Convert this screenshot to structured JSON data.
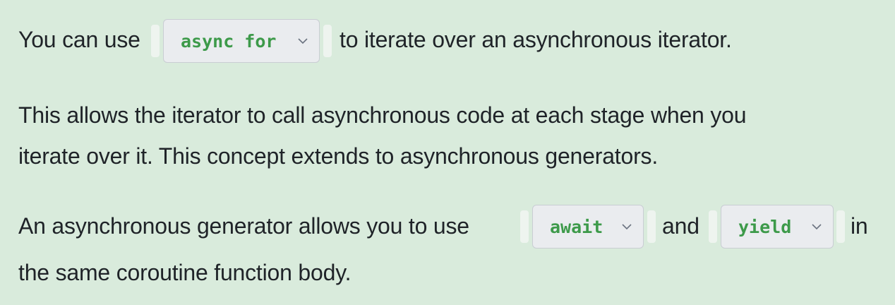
{
  "paragraph1": {
    "before": "You can use",
    "after": "to iterate over an asynchronous iterator.",
    "dropdown_value": "async for"
  },
  "paragraph2": {
    "line1": "This allows the iterator to call asynchronous code at each stage when you",
    "line2": "iterate over it. This concept extends to asynchronous generators."
  },
  "paragraph3": {
    "before": "An asynchronous generator allows you to use",
    "middle": "and",
    "after": "in",
    "line2": "the same coroutine function body.",
    "dropdown1_value": "await",
    "dropdown2_value": "yield"
  },
  "icons": {
    "dropdown_chevron": "chevron-down-icon"
  },
  "colors": {
    "background": "#d9ebdc",
    "code_text": "#3d9a4a",
    "dropdown_bg": "#eaecef"
  }
}
